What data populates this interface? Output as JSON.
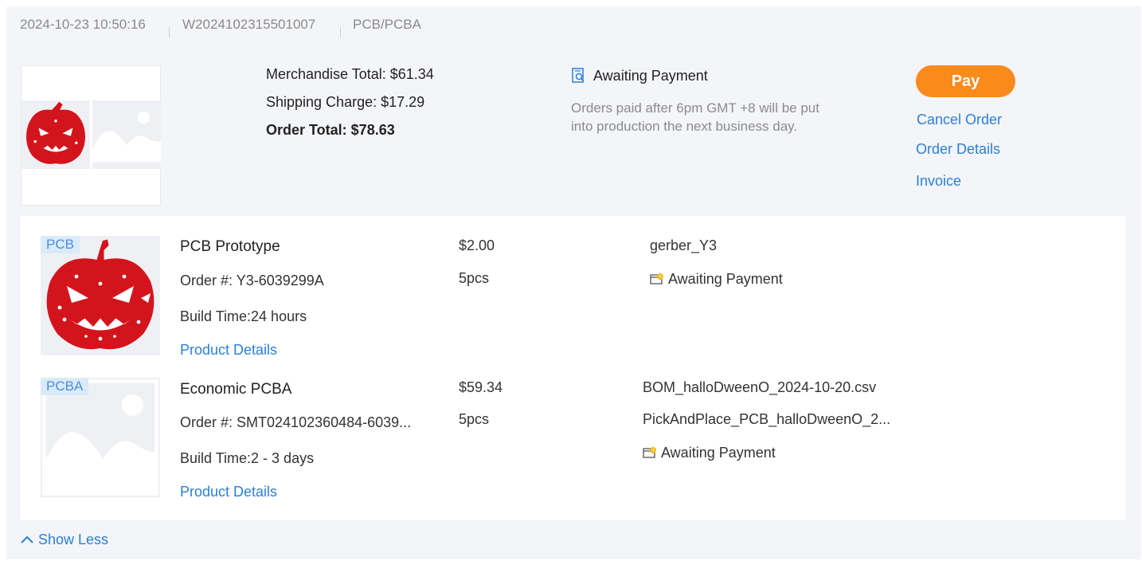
{
  "header": {
    "datetime": "2024-10-23 10:50:16",
    "order_id": "W2024102315501007",
    "category": "PCB/PCBA"
  },
  "summary": {
    "merchandise_total": "Merchandise Total: $61.34",
    "shipping_charge": "Shipping Charge: $17.29",
    "order_total": "Order Total: $78.63"
  },
  "status": {
    "label": "Awaiting Payment",
    "note": "Orders paid after 6pm GMT +8 will be put into production the next business day."
  },
  "actions": {
    "pay": "Pay",
    "cancel": "Cancel Order",
    "details": "Order Details",
    "invoice": "Invoice"
  },
  "items": [
    {
      "tag": "PCB",
      "name": "PCB Prototype",
      "order_no": "Order #: Y3-6039299A",
      "build_time": "Build Time:24 hours",
      "details_link": "Product Details",
      "price": "$2.00",
      "qty": "5pcs",
      "files": [
        "gerber_Y3"
      ],
      "status": "Awaiting Payment"
    },
    {
      "tag": "PCBA",
      "name": "Economic PCBA",
      "order_no": "Order #: SMT024102360484-6039...",
      "build_time": "Build Time:2 - 3 days",
      "details_link": "Product Details",
      "price": "$59.34",
      "qty": "5pcs",
      "files": [
        "BOM_halloDweenO_2024-10-20.csv",
        "PickAndPlace_PCB_halloDweenO_2..."
      ],
      "status": "Awaiting Payment"
    }
  ],
  "footer": {
    "show_less": "Show Less"
  },
  "colors": {
    "accent": "#fb8a1c",
    "link": "#2a7fd8",
    "pcb_red": "#d4141c"
  },
  "icons": [
    "search-document-icon",
    "pending-payment-icon",
    "chevron-up-icon",
    "image-placeholder-icon"
  ]
}
